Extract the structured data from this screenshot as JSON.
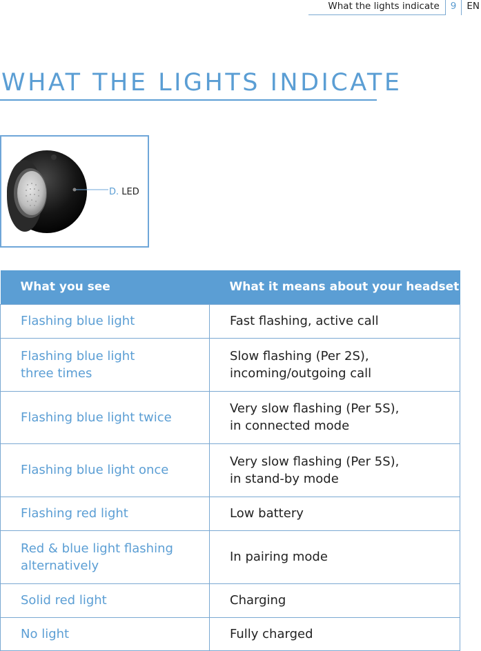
{
  "running_header": {
    "section_title": "What the lights indicate",
    "page_number": "9",
    "language": "EN"
  },
  "page_title": "WHAT THE LIGHTS INDICATE",
  "figure": {
    "callout_letter": "D.",
    "callout_text": " LED",
    "image": "headset-earpiece-illustration"
  },
  "colors": {
    "accent": "#5b9ed4",
    "border": "#7aa8d2",
    "text": "#222222",
    "header_text": "#ffffff"
  },
  "table": {
    "headers": [
      "What you see",
      "What it means about your headset"
    ],
    "rows": [
      {
        "see": "Flashing blue light",
        "means": "Fast flashing, active call"
      },
      {
        "see": "Flashing blue light\nthree times",
        "means": "Slow flashing (Per 2S),\nincoming/outgoing call"
      },
      {
        "see": "Flashing blue light twice",
        "means": "Very slow flashing (Per 5S),\nin connected mode"
      },
      {
        "see": "Flashing blue light once",
        "means": "Very slow flashing (Per 5S),\nin stand-by mode"
      },
      {
        "see": "Flashing red light",
        "means": "Low battery"
      },
      {
        "see": "Red & blue light flashing\nalternatively",
        "means": "In pairing mode"
      },
      {
        "see": "Solid red light",
        "means": "Charging"
      },
      {
        "see": "No light",
        "means": "Fully charged"
      }
    ]
  }
}
